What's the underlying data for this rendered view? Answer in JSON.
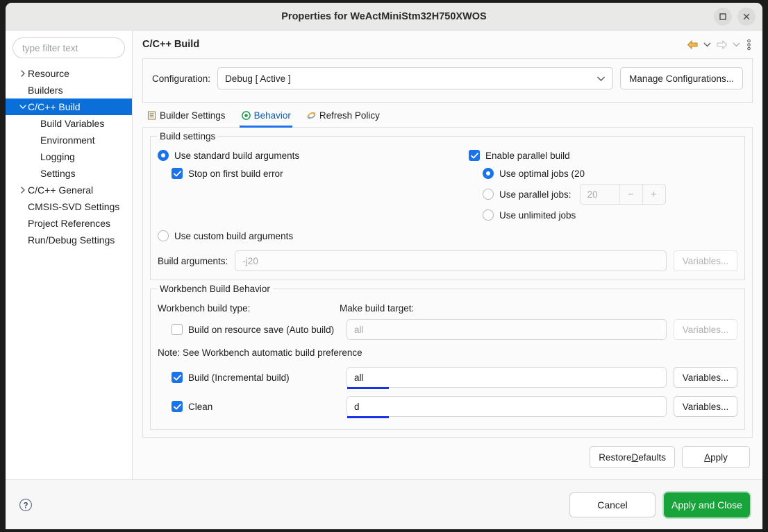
{
  "window": {
    "title": "Properties for WeActMiniStm32H750XWOS",
    "maximize_label": "Maximize",
    "close_label": "Close"
  },
  "sidebar": {
    "filter_placeholder": "type filter text",
    "filter_value": "",
    "items": [
      {
        "label": "Resource",
        "level": 0,
        "twisty": "collapsed",
        "selected": false
      },
      {
        "label": "Builders",
        "level": 0,
        "twisty": "none",
        "selected": false
      },
      {
        "label": "C/C++ Build",
        "level": 0,
        "twisty": "expanded",
        "selected": true
      },
      {
        "label": "Build Variables",
        "level": 1,
        "twisty": "none",
        "selected": false
      },
      {
        "label": "Environment",
        "level": 1,
        "twisty": "none",
        "selected": false
      },
      {
        "label": "Logging",
        "level": 1,
        "twisty": "none",
        "selected": false
      },
      {
        "label": "Settings",
        "level": 1,
        "twisty": "none",
        "selected": false
      },
      {
        "label": "C/C++ General",
        "level": 0,
        "twisty": "collapsed",
        "selected": false
      },
      {
        "label": "CMSIS-SVD Settings",
        "level": 0,
        "twisty": "none",
        "selected": false
      },
      {
        "label": "Project References",
        "level": 0,
        "twisty": "none",
        "selected": false
      },
      {
        "label": "Run/Debug Settings",
        "level": 0,
        "twisty": "none",
        "selected": false
      }
    ]
  },
  "page": {
    "title": "C/C++ Build",
    "tools": {
      "back": "back-arrow",
      "back_menu": "chevron-down",
      "forward": "forward-arrow",
      "forward_menu": "chevron-down",
      "overflow": "view-menu"
    }
  },
  "configuration": {
    "label": "Configuration:",
    "selected": "Debug  [ Active ]",
    "manage_label": "Manage Configurations..."
  },
  "tabs": [
    {
      "label": "Builder Settings",
      "icon": "builder-settings-icon",
      "active": false
    },
    {
      "label": "Behavior",
      "icon": "behavior-icon",
      "active": true
    },
    {
      "label": "Refresh Policy",
      "icon": "refresh-policy-icon",
      "active": false
    }
  ],
  "build_settings": {
    "group_title": "Build settings",
    "use_standard": {
      "label": "Use standard build arguments",
      "checked": true
    },
    "stop_on_first_error": {
      "label": "Stop on first build error",
      "checked": true
    },
    "use_custom": {
      "label": "Use custom build arguments",
      "checked": false
    },
    "build_arguments": {
      "label": "Build arguments:",
      "value": "",
      "placeholder": "-j20",
      "variables_label": "Variables...",
      "variables_enabled": false
    },
    "parallel": {
      "enable_label": "Enable parallel build",
      "enable_checked": true,
      "optimal_label": "Use optimal jobs (20",
      "optimal_checked": true,
      "parallel_label": "Use parallel jobs:",
      "parallel_checked": false,
      "parallel_value": "20",
      "spin_down": "−",
      "spin_up": "+",
      "unlimited_label": "Use unlimited jobs",
      "unlimited_checked": false
    }
  },
  "workbench": {
    "group_title": "Workbench Build Behavior",
    "build_type_label": "Workbench build type:",
    "make_target_label": "Make build target:",
    "note": "Note: See Workbench automatic build preference",
    "rows": [
      {
        "label": "Build on resource save (Auto build)",
        "checked": false,
        "target_value": "",
        "target_placeholder": "all",
        "target_focused": false,
        "variables_label": "Variables...",
        "variables_enabled": false
      },
      {
        "label": "Build (Incremental build)",
        "checked": true,
        "target_value": "all",
        "target_placeholder": "",
        "target_focused": true,
        "variables_label": "Variables...",
        "variables_enabled": true
      },
      {
        "label": "Clean",
        "checked": true,
        "target_value": "d",
        "target_placeholder": "",
        "target_focused": true,
        "variables_label": "Variables...",
        "variables_enabled": true
      }
    ]
  },
  "page_buttons": {
    "restore_defaults_pre": "Restore ",
    "restore_defaults_mnemonic": "D",
    "restore_defaults_post": "efaults",
    "apply_mnemonic": "A",
    "apply_post": "pply"
  },
  "footer": {
    "help_label": "Help",
    "cancel_label": "Cancel",
    "apply_close_label": "Apply and Close"
  },
  "colors": {
    "selection_blue": "#0a6fd8",
    "tab_accent": "#1a73e8",
    "field_focus_underline": "#1a31e8",
    "primary_green": "#18a33b",
    "back_arrow": "#e8a33d"
  }
}
